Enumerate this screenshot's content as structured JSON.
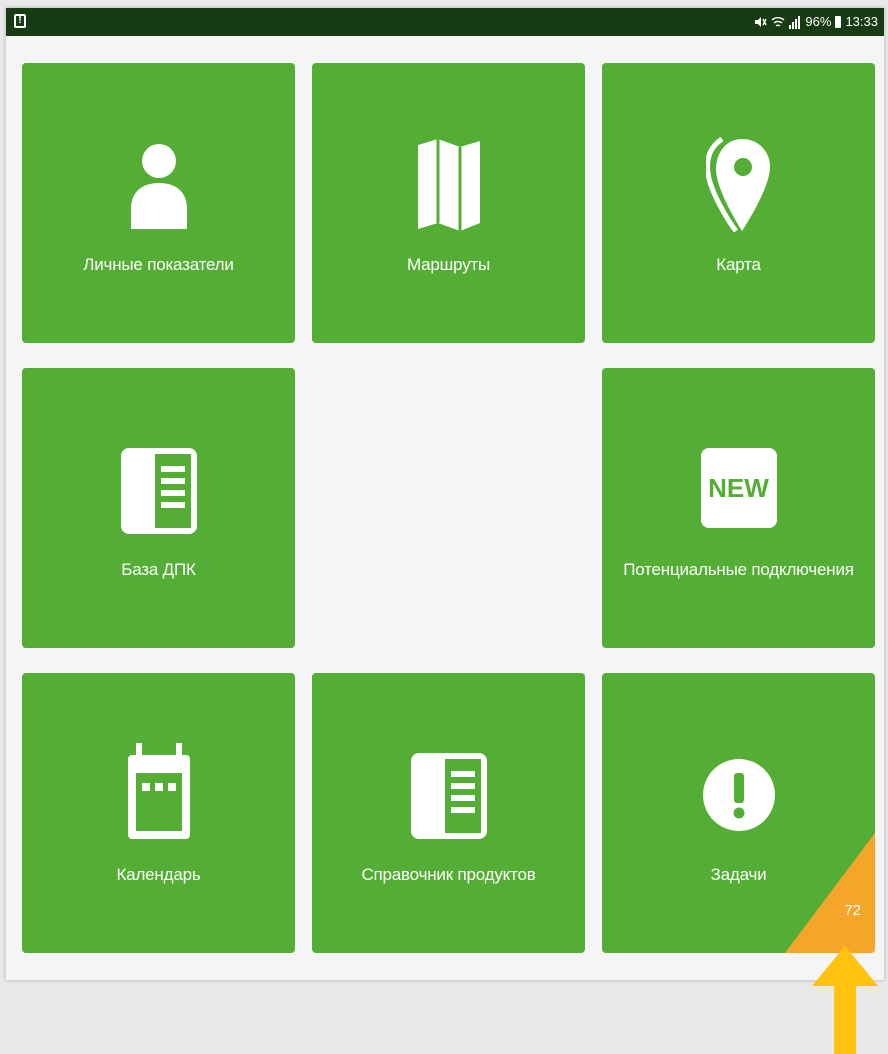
{
  "status_bar": {
    "battery": "96%",
    "time": "13:33"
  },
  "tiles": [
    {
      "label": "Личные показатели",
      "icon": "person-icon"
    },
    {
      "label": "Маршруты",
      "icon": "map-icon"
    },
    {
      "label": "Карта",
      "icon": "location-pin-icon"
    },
    {
      "label": "База ДПК",
      "icon": "book-icon"
    },
    {
      "label": "Потенциальные подключения",
      "icon": "new-badge-icon",
      "icon_text": "NEW"
    },
    {
      "label": "Календарь",
      "icon": "calendar-icon"
    },
    {
      "label": "Справочник продуктов",
      "icon": "book-icon"
    },
    {
      "label": "Задачи",
      "icon": "exclamation-icon",
      "badge_count": "72"
    }
  ],
  "colors": {
    "tile_green": "#54ad34",
    "status_bar": "#173b13",
    "badge_orange": "#f5a62a",
    "arrow_yellow": "#ffc20e",
    "background": "#f5f5f5"
  }
}
